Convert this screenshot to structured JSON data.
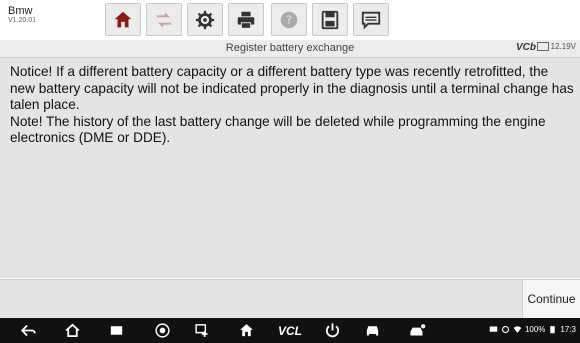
{
  "app": {
    "name": "Bmw",
    "version": "V1.20.01"
  },
  "toolbar": {
    "buttons": [
      {
        "icon": "home-icon",
        "enabled": true
      },
      {
        "icon": "vehicle-swap-icon",
        "enabled": false
      },
      {
        "icon": "settings-icon",
        "enabled": true
      },
      {
        "icon": "print-icon",
        "enabled": true
      },
      {
        "icon": "help-icon",
        "enabled": false
      },
      {
        "icon": "save-icon",
        "enabled": true
      },
      {
        "icon": "data-logging-icon",
        "enabled": true
      }
    ]
  },
  "status": {
    "title": "Register battery exchange",
    "vci": "VCb",
    "voltage": "12.19V"
  },
  "message": {
    "line1": "Notice! If a different battery capacity or a different battery type was recently retrofitted, the new battery capacity will not be indicated properly in the diagnosis until a terminal change has talen place.",
    "line2": "Note! The history of the last battery change will be deleted while programming the engine electronics (DME or DDE)."
  },
  "actions": {
    "continue_label": "Continue"
  },
  "navbar": {
    "vcl_label": "VCL",
    "battery_level": "100%",
    "time": "17:3"
  },
  "colors": {
    "content_bg": "#e4e4e4",
    "toolbar_accent": "#8b1a1a",
    "navbar_bg": "#111111"
  }
}
